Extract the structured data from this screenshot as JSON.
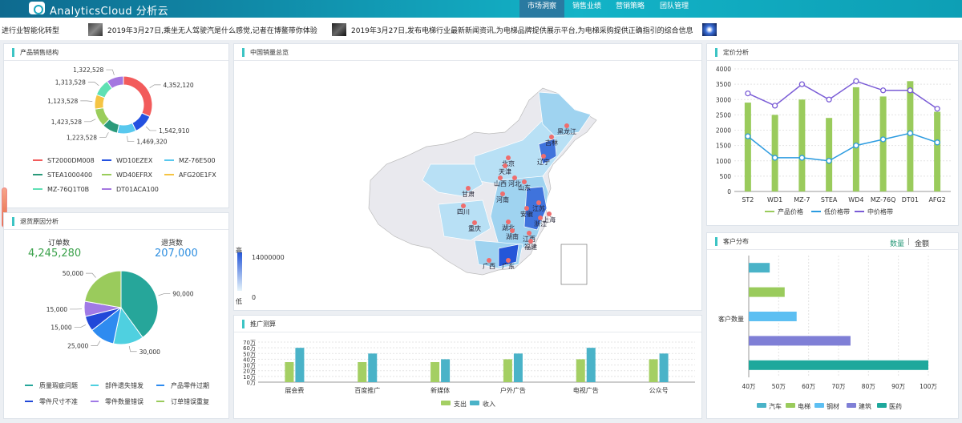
{
  "app": {
    "title": "AnalyticsCloud 分析云"
  },
  "nav": [
    "市场洞察",
    "销售业绩",
    "营销策略",
    "团队管理"
  ],
  "news": [
    "进行业智能化转型",
    "2019年3月27日,乘坐无人驾驶汽是什么感觉,记者在博鳌带你体验",
    "2019年3月27日,发布电梯行业最新新闻资讯,为电梯品牌提供展示平台,为电梯采购提供正确指引的综合信息"
  ],
  "product_structure": {
    "title": "产品销售结构",
    "chart_data": {
      "type": "pie",
      "labels": [
        "ST2000DM008",
        "WD10EZEX",
        "MZ-76E500",
        "STEA1000400",
        "WD40EFRX",
        "AFG20E1FX",
        "MZ-76Q1T0B",
        "DT01ACA100"
      ],
      "values": [
        4352120,
        1542910,
        1469320,
        1223528,
        1423528,
        1123528,
        1313528,
        1322528
      ],
      "value_labels": [
        "4,352,120",
        "1,542,910",
        "1,469,320",
        "1,223,528",
        "1,423,528",
        "1,123,528",
        "1,313,528",
        "1,322,528"
      ],
      "colors": [
        "#f25b5b",
        "#2451e0",
        "#58c8ee",
        "#2a9a7a",
        "#9acd5b",
        "#f5c443",
        "#5fe0b4",
        "#a477e0"
      ]
    }
  },
  "returns": {
    "title": "退货原因分析",
    "orders_label": "订单数",
    "orders_value": "4,245,280",
    "returns_label": "退货数",
    "returns_value": "207,000",
    "chart_data": {
      "type": "pie",
      "labels": [
        "质量瑕疵问题",
        "部件遗失错发",
        "产品零件过期",
        "零件尺寸不准",
        "零件数量错误",
        "订单错误重复"
      ],
      "values": [
        90000,
        30000,
        25000,
        15000,
        15000,
        50000
      ],
      "value_labels": [
        "90,000",
        "30,000",
        "25,000",
        "15,000",
        "15,000",
        "50,000"
      ],
      "colors": [
        "#26a69a",
        "#4fd0e0",
        "#2e8bf0",
        "#2148d8",
        "#a07ae6",
        "#9acb5c"
      ]
    }
  },
  "map": {
    "title": "中国销量总览",
    "legend_high": "高",
    "legend_low": "低",
    "legend_max": "14000000",
    "legend_min": "0",
    "labels": [
      "黑龙江",
      "吉林",
      "辽宁",
      "北京",
      "天津",
      "河北",
      "山西",
      "山东",
      "甘肃",
      "河南",
      "江苏",
      "安徽",
      "四川",
      "重庆",
      "湖北",
      "浙江",
      "湖南",
      "江西",
      "福建",
      "广西",
      "广东",
      "上海"
    ]
  },
  "promotion": {
    "title": "推广测算",
    "chart_data": {
      "type": "bar",
      "categories": [
        "展会费",
        "百度推广",
        "新媒体",
        "户外广告",
        "电视广告",
        "公众号"
      ],
      "series": [
        {
          "name": "支出",
          "values": [
            35,
            35,
            35,
            40,
            40,
            40
          ],
          "color": "#a4cf63"
        },
        {
          "name": "收入",
          "values": [
            60,
            50,
            40,
            50,
            60,
            50
          ],
          "color": "#4ab3c8"
        }
      ],
      "ylim": [
        0,
        70
      ],
      "yticks": [
        "0万",
        "10万",
        "20万",
        "30万",
        "40万",
        "50万",
        "60万",
        "70万"
      ]
    }
  },
  "pricing": {
    "title": "定价分析",
    "chart_data": {
      "type": "bar",
      "categories": [
        "ST2",
        "WD1",
        "MZ-7",
        "STEA",
        "WD4",
        "MZ-76Q",
        "DT01",
        "AFG2"
      ],
      "series": [
        {
          "name": "产品价格",
          "type": "bar",
          "values": [
            2900,
            2500,
            3000,
            2400,
            3400,
            3100,
            3600,
            2600
          ],
          "color": "#9acb5c"
        },
        {
          "name": "低价格带",
          "type": "line",
          "values": [
            1800,
            1100,
            1100,
            1000,
            1500,
            1700,
            1900,
            1600
          ],
          "color": "#2b9be0"
        },
        {
          "name": "中价格带",
          "type": "line",
          "values": [
            3200,
            2800,
            3500,
            3000,
            3600,
            3300,
            3300,
            2700
          ],
          "color": "#7a5cd6"
        }
      ],
      "ylim": [
        0,
        4000
      ],
      "yticks": [
        "0",
        "500",
        "1000",
        "1500",
        "2000",
        "2500",
        "3000",
        "3500",
        "4000"
      ]
    }
  },
  "customers": {
    "title": "客户分布",
    "toggle_count": "数量",
    "toggle_sep": "|",
    "toggle_amount": "金额",
    "ylabel": "客户数量",
    "chart_data": {
      "type": "bar",
      "orientation": "horizontal",
      "categories": [
        "汽车",
        "电梯",
        "钢材",
        "建筑",
        "医药"
      ],
      "values": [
        47,
        52,
        56,
        74,
        100
      ],
      "colors": [
        "#4ab3c8",
        "#9acb5c",
        "#5dbff2",
        "#7f7fd6",
        "#1ea89c"
      ],
      "xlim": [
        40,
        100
      ],
      "xticks": [
        "40万",
        "50万",
        "60万",
        "70万",
        "80万",
        "90万",
        "100万"
      ]
    }
  }
}
